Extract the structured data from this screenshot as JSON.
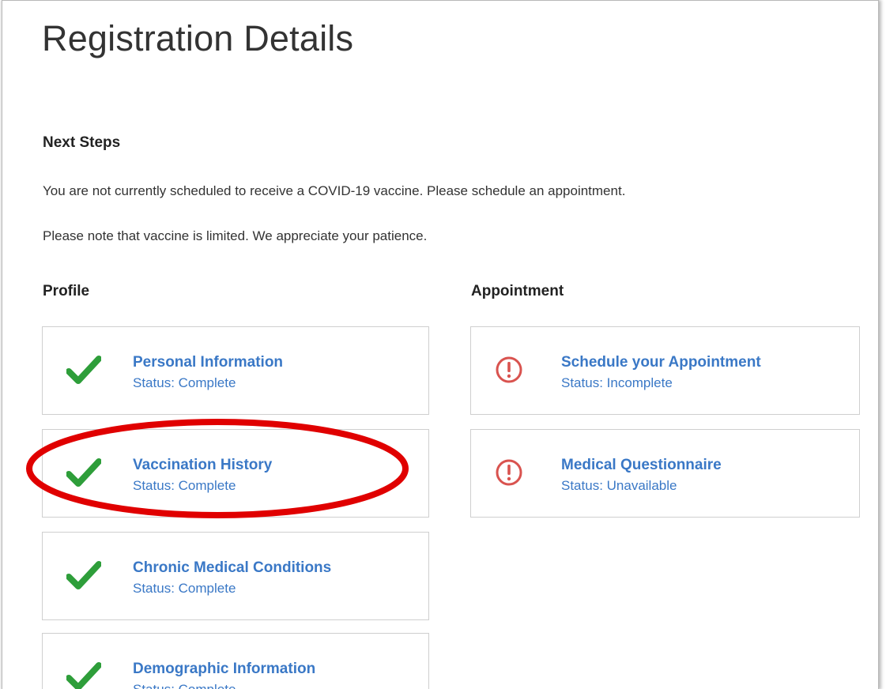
{
  "page": {
    "title": "Registration Details"
  },
  "next_steps": {
    "heading": "Next Steps",
    "line1": "You are not currently scheduled to receive a COVID-19 vaccine. Please schedule an appointment.",
    "line2": "Please note that vaccine is limited. We appreciate your patience."
  },
  "profile": {
    "heading": "Profile",
    "items": [
      {
        "title": "Personal Information",
        "status": "Status: Complete",
        "icon": "checkmark-icon"
      },
      {
        "title": "Vaccination History",
        "status": "Status: Complete",
        "icon": "checkmark-icon"
      },
      {
        "title": "Chronic Medical Conditions",
        "status": "Status: Complete",
        "icon": "checkmark-icon"
      },
      {
        "title": "Demographic Information",
        "status": "Status: Complete",
        "icon": "checkmark-icon"
      }
    ]
  },
  "appointment": {
    "heading": "Appointment",
    "items": [
      {
        "title": "Schedule your Appointment",
        "status": "Status: Incomplete",
        "icon": "alert-circle-icon"
      },
      {
        "title": "Medical Questionnaire",
        "status": "Status: Unavailable",
        "icon": "alert-circle-icon"
      }
    ]
  },
  "colors": {
    "link": "#3a78c6",
    "complete": "#2e9e3a",
    "alert": "#d9534f",
    "highlight": "#e00000"
  }
}
